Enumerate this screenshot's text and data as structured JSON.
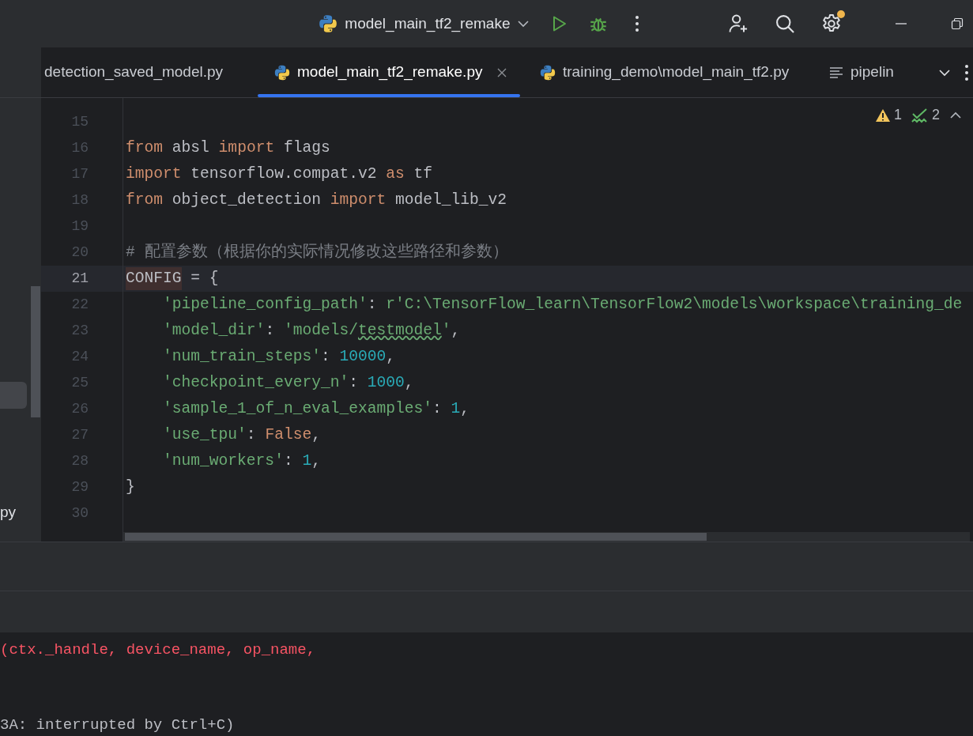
{
  "toolbar": {
    "run_config": "model_main_tf2_remake",
    "settings_badge": true
  },
  "tabs": [
    {
      "label": "detection_saved_model.py",
      "kind": "plain",
      "selected": false
    },
    {
      "label": "model_main_tf2_remake.py",
      "kind": "python",
      "selected": true
    },
    {
      "label": "training_demo\\model_main_tf2.py",
      "kind": "python",
      "selected": false
    },
    {
      "label": "pipelin",
      "kind": "text",
      "selected": false
    }
  ],
  "inspections": {
    "warnings": "1",
    "weak_warnings": "2"
  },
  "project_panel": {
    "file_fragment": "py"
  },
  "editor": {
    "lines": [
      {
        "number": "15",
        "current": false,
        "kind": "top"
      },
      {
        "number": "16",
        "current": false,
        "kind": "top",
        "tokens": [
          {
            "text": "from",
            "kind": "keyword"
          },
          {
            "text": " absl ",
            "kind": "plain"
          },
          {
            "text": "import",
            "kind": "keyword"
          },
          {
            "text": " flags",
            "kind": "plain"
          }
        ]
      },
      {
        "number": "17",
        "current": false,
        "kind": "top",
        "tokens": [
          {
            "text": "import",
            "kind": "keyword"
          },
          {
            "text": " tensorflow.compat.v2 ",
            "kind": "plain"
          },
          {
            "text": "as",
            "kind": "keyword"
          },
          {
            "text": " tf",
            "kind": "plain"
          }
        ]
      },
      {
        "number": "18",
        "current": false,
        "kind": "top",
        "tokens": [
          {
            "text": "from",
            "kind": "keyword"
          },
          {
            "text": " object_detection ",
            "kind": "plain"
          },
          {
            "text": "import",
            "kind": "keyword"
          },
          {
            "text": " model_lib_v2",
            "kind": "plain"
          }
        ]
      },
      {
        "number": "19",
        "current": false,
        "kind": "top"
      },
      {
        "number": "20",
        "current": false,
        "kind": "top",
        "tokens": [
          {
            "text": "# 配置参数（根据你的实际情况修改这些路径和参数）",
            "kind": "comment"
          }
        ]
      },
      {
        "number": "21",
        "current": true,
        "kind": "top",
        "tokens": [
          {
            "text": "CONFIG",
            "kind": "highlighted"
          },
          {
            "text": " = {",
            "kind": "plain"
          }
        ]
      },
      {
        "number": "22",
        "current": false,
        "kind": "nested",
        "tokens": [
          {
            "text": "'pipeline_config_path'",
            "kind": "string"
          },
          {
            "text": ": ",
            "kind": "plain"
          },
          {
            "text": "r'C:\\TensorFlow_learn\\TensorFlow2\\models\\workspace\\training_de",
            "kind": "string"
          }
        ]
      },
      {
        "number": "23",
        "current": false,
        "kind": "nested",
        "tokens": [
          {
            "text": "'model_dir'",
            "kind": "string"
          },
          {
            "text": ": ",
            "kind": "plain"
          },
          {
            "text": "'models/",
            "kind": "string"
          },
          {
            "text": "testmodel",
            "kind": "typo"
          },
          {
            "text": "'",
            "kind": "string"
          },
          {
            "text": ",",
            "kind": "plain"
          }
        ]
      },
      {
        "number": "24",
        "current": false,
        "kind": "nested",
        "tokens": [
          {
            "text": "'num_train_steps'",
            "kind": "string"
          },
          {
            "text": ": ",
            "kind": "plain"
          },
          {
            "text": "10000",
            "kind": "number"
          },
          {
            "text": ",",
            "kind": "plain"
          }
        ]
      },
      {
        "number": "25",
        "current": false,
        "kind": "nested",
        "tokens": [
          {
            "text": "'checkpoint_every_n'",
            "kind": "string"
          },
          {
            "text": ": ",
            "kind": "plain"
          },
          {
            "text": "1000",
            "kind": "number"
          },
          {
            "text": ",",
            "kind": "plain"
          }
        ]
      },
      {
        "number": "26",
        "current": false,
        "kind": "nested",
        "tokens": [
          {
            "text": "'sample_1_of_n_eval_examples'",
            "kind": "string"
          },
          {
            "text": ": ",
            "kind": "plain"
          },
          {
            "text": "1",
            "kind": "number"
          },
          {
            "text": ",",
            "kind": "plain"
          }
        ]
      },
      {
        "number": "27",
        "current": false,
        "kind": "nested",
        "tokens": [
          {
            "text": "'use_tpu'",
            "kind": "string"
          },
          {
            "text": ": ",
            "kind": "plain"
          },
          {
            "text": "False",
            "kind": "keyword"
          },
          {
            "text": ",",
            "kind": "plain"
          }
        ]
      },
      {
        "number": "28",
        "current": false,
        "kind": "nested",
        "tokens": [
          {
            "text": "'num_workers'",
            "kind": "string"
          },
          {
            "text": ": ",
            "kind": "plain"
          },
          {
            "text": "1",
            "kind": "number"
          },
          {
            "text": ",",
            "kind": "plain"
          }
        ]
      },
      {
        "number": "29",
        "current": false,
        "kind": "top",
        "tokens": [
          {
            "text": "}",
            "kind": "plain"
          }
        ]
      },
      {
        "number": "30",
        "current": false,
        "kind": "top"
      }
    ]
  },
  "console": {
    "lines": [
      {
        "text": "(ctx._handle, device_name, op_name,",
        "kind": "error"
      },
      {
        "text": "3A: interrupted by Ctrl+C)",
        "kind": "plain"
      }
    ]
  }
}
